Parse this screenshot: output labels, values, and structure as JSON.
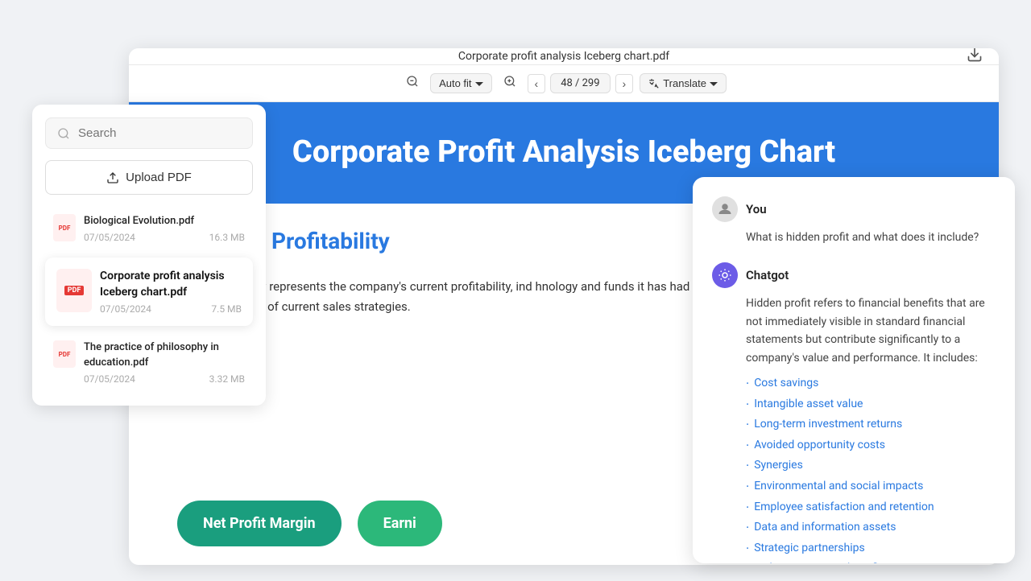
{
  "app": {
    "bg_color": "#f0f2f5"
  },
  "pdf_viewer": {
    "filename": "Corporate profit analysis Iceberg chart.pdf",
    "toolbar": {
      "zoom_out_icon": "−",
      "zoom_in_icon": "+",
      "auto_fit_label": "Auto fit",
      "page_indicator": "48 / 299",
      "translate_label": "Translate",
      "download_icon": "⬇"
    },
    "page": {
      "header_title": "Corporate Profit Analysis Iceberg Chart",
      "section_title": "Explicit Profitability",
      "section_text": "plicit profitability represents the company's current profitability, ind hnology and funds it has had in the past. It directly reflects the co d facilitates the modification of current sales strategies.",
      "pill1_label": "Net Profit Margin",
      "pill2_label": "Earni"
    }
  },
  "sidebar": {
    "search_placeholder": "Search",
    "upload_label": "Upload PDF",
    "files": [
      {
        "name": "Biological Evolution.pdf",
        "date": "07/05/2024",
        "size": "16.3 MB",
        "active": false
      },
      {
        "name": "Corporate profit analysis Iceberg chart.pdf",
        "date": "07/05/2024",
        "size": "7.5 MB",
        "active": true
      },
      {
        "name": "The practice of philosophy in education.pdf",
        "date": "07/05/2024",
        "size": "3.32 MB",
        "active": false
      }
    ]
  },
  "chat": {
    "user_name": "You",
    "user_question": "What is hidden profit and what does it include?",
    "ai_name": "Chatgot",
    "ai_response": "Hidden profit refers to financial benefits that are not immediately visible in standard financial statements but contribute significantly to a company's value and performance. It includes:",
    "ai_list": [
      "Cost savings",
      "Intangible asset value",
      "Long-term investment returns",
      "Avoided opportunity costs",
      "Synergies",
      "Environmental and social impacts",
      "Employee satisfaction and retention",
      "Data and information assets",
      "Strategic partnerships",
      "Risk management benefits"
    ]
  }
}
